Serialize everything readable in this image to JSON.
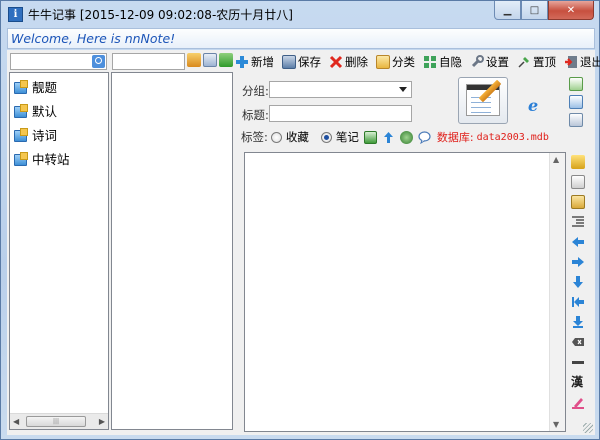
{
  "window": {
    "app_title": "牛牛记事 [2015-12-09 09:02:08-农历十月廿八]",
    "minimize_symbol": "▁",
    "maximize_symbol": "□",
    "close_symbol": "✕",
    "app_icon_letter": "i"
  },
  "welcome": {
    "text": "Welcome, Here is nnNote!"
  },
  "sidebar": {
    "items": [
      {
        "label": "靓题"
      },
      {
        "label": "默认"
      },
      {
        "label": "诗词"
      },
      {
        "label": "中转站"
      }
    ]
  },
  "toolbar": {
    "new": "新增",
    "save": "保存",
    "delete": "删除",
    "category": "分类",
    "hide": "自隐",
    "settings": "设置",
    "pin": "置顶",
    "exit": "退出"
  },
  "form": {
    "group_label": "分组:",
    "group_value": "",
    "title_label": "标题:",
    "title_value": "",
    "tag_label": "标签:",
    "radio_favorite": "收藏",
    "radio_note": "笔记",
    "selected_radio": "笔记",
    "database_label": "数据库:",
    "database_value": "data2003.mdb"
  },
  "editor": {
    "content": ""
  },
  "colors": {
    "accent": "#1c55b8",
    "database_text": "#e0201b",
    "frame": "#b9cfea"
  },
  "icons": {
    "toolbar_new": "plus-icon",
    "toolbar_save": "save-icon",
    "toolbar_delete": "x-icon",
    "toolbar_category": "category-icon",
    "toolbar_hide": "hide-icon",
    "toolbar_settings": "wrench-icon",
    "toolbar_pin": "pin-icon",
    "toolbar_exit": "exit-icon",
    "editor_logo": "notepad-pencil-icon",
    "browser": "ie-icon",
    "format_text": "漢"
  }
}
